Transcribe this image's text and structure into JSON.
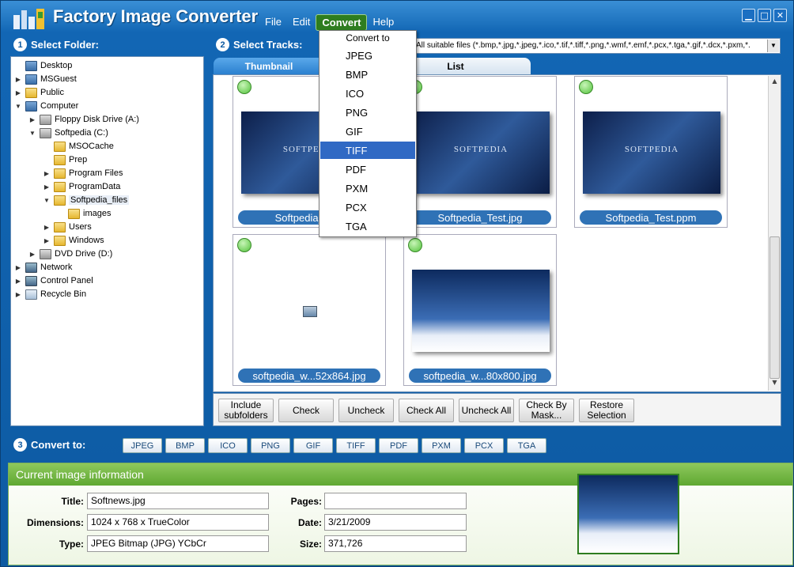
{
  "app": {
    "title": "Factory Image Converter"
  },
  "menu": {
    "items": [
      "File",
      "Edit",
      "Convert",
      "Help"
    ],
    "active": "Convert"
  },
  "convert_menu": {
    "header": "Convert to",
    "items": [
      "JPEG",
      "BMP",
      "ICO",
      "PNG",
      "GIF",
      "TIFF",
      "PDF",
      "PXM",
      "PCX",
      "TGA"
    ],
    "highlighted": "TIFF"
  },
  "sections": {
    "folder": {
      "num": "1",
      "label": "Select Folder:"
    },
    "tracks": {
      "num": "2",
      "label": "Select Tracks:"
    },
    "convert": {
      "num": "3",
      "label": "Convert to:"
    }
  },
  "filter": {
    "value": "All suitable files (*.bmp,*.jpg,*.jpeg,*.ico,*.tif,*.tiff,*.png,*.wmf,*.emf,*.pcx,*.tga,*.gif,*.dcx,*.pxm,*."
  },
  "tabs": {
    "thumbnail": "Thumbnail",
    "list": "List"
  },
  "tree": [
    {
      "label": "Desktop",
      "icon": "monitor-icon"
    },
    {
      "label": "MSGuest",
      "icon": "user-icon"
    },
    {
      "label": "Public",
      "icon": "folder-icon"
    },
    {
      "label": "Computer",
      "icon": "computer-icon"
    },
    {
      "label": "Floppy Disk Drive (A:)",
      "icon": "floppy-icon"
    },
    {
      "label": "Softpedia (C:)",
      "icon": "drive-icon"
    },
    {
      "label": "MSOCache",
      "icon": "folder-icon"
    },
    {
      "label": "Prep",
      "icon": "folder-icon"
    },
    {
      "label": "Program Files",
      "icon": "folder-icon"
    },
    {
      "label": "ProgramData",
      "icon": "folder-icon"
    },
    {
      "label": "Softpedia_files",
      "icon": "folder-icon"
    },
    {
      "label": "images",
      "icon": "folder-icon"
    },
    {
      "label": "Users",
      "icon": "folder-icon"
    },
    {
      "label": "Windows",
      "icon": "folder-icon"
    },
    {
      "label": "DVD Drive (D:)",
      "icon": "dvd-icon"
    },
    {
      "label": "Network",
      "icon": "network-icon"
    },
    {
      "label": "Control Panel",
      "icon": "control-panel-icon"
    },
    {
      "label": "Recycle Bin",
      "icon": "recycle-bin-icon"
    }
  ],
  "thumbnails": [
    {
      "caption": "Softpedia_...nv",
      "image_text": "SOFTPEDIA"
    },
    {
      "caption": "Softpedia_Test.jpg",
      "image_text": "SOFTPEDIA"
    },
    {
      "caption": "Softpedia_Test.ppm",
      "image_text": "SOFTPEDIA"
    },
    {
      "caption": "softpedia_w...52x864.jpg",
      "image_text": ""
    },
    {
      "caption": "softpedia_w...80x800.jpg",
      "image_text": ""
    }
  ],
  "actions": {
    "include_subfolders": "Include subfolders",
    "check": "Check",
    "uncheck": "Uncheck",
    "check_all": "Check All",
    "uncheck_all": "Uncheck All",
    "check_by_mask": "Check By Mask...",
    "restore_selection": "Restore Selection"
  },
  "formats": [
    "JPEG",
    "BMP",
    "ICO",
    "PNG",
    "GIF",
    "TIFF",
    "PDF",
    "PXM",
    "PCX",
    "TGA"
  ],
  "info": {
    "header": "Current image information",
    "title_label": "Title:",
    "title": "Softnews.jpg",
    "dimensions_label": "Dimensions:",
    "dimensions": "1024 x 768 x TrueColor",
    "type_label": "Type:",
    "type": "JPEG Bitmap (JPG) YCbCr",
    "pages_label": "Pages:",
    "pages": "",
    "date_label": "Date:",
    "date": "3/21/2009",
    "size_label": "Size:",
    "size": "371,726"
  },
  "colors": {
    "accent": "#1266b4",
    "green": "#5fa832",
    "highlight": "#3069c4"
  }
}
